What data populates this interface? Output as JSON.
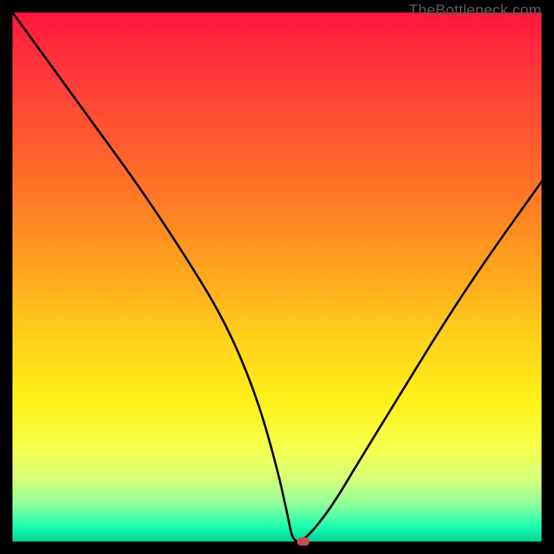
{
  "watermark": "TheBottleneck.com",
  "chart_data": {
    "type": "line",
    "title": "",
    "xlabel": "",
    "ylabel": "",
    "xlim": [
      0,
      100
    ],
    "ylim": [
      0,
      100
    ],
    "series": [
      {
        "name": "curve",
        "x": [
          0,
          8,
          16,
          24,
          32,
          40,
          46,
          50,
          52,
          53,
          55,
          60,
          66,
          74,
          82,
          90,
          100
        ],
        "y": [
          100,
          89,
          78,
          67,
          55,
          42,
          28,
          14,
          5,
          0,
          0,
          6,
          16,
          29,
          42,
          54,
          68
        ]
      }
    ],
    "marker": {
      "x": 55,
      "y": 0,
      "color": "#c94f4f"
    },
    "gradient_stops": [
      {
        "pos": 0,
        "color": "#ff163f"
      },
      {
        "pos": 12,
        "color": "#ff3a3a"
      },
      {
        "pos": 30,
        "color": "#ff6a2a"
      },
      {
        "pos": 48,
        "color": "#ffa21e"
      },
      {
        "pos": 62,
        "color": "#ffd21a"
      },
      {
        "pos": 74,
        "color": "#fff21a"
      },
      {
        "pos": 82,
        "color": "#f6ff4a"
      },
      {
        "pos": 88,
        "color": "#d8ff7a"
      },
      {
        "pos": 93,
        "color": "#8dff9a"
      },
      {
        "pos": 97,
        "color": "#1fffb0"
      },
      {
        "pos": 100,
        "color": "#00d097"
      }
    ]
  }
}
